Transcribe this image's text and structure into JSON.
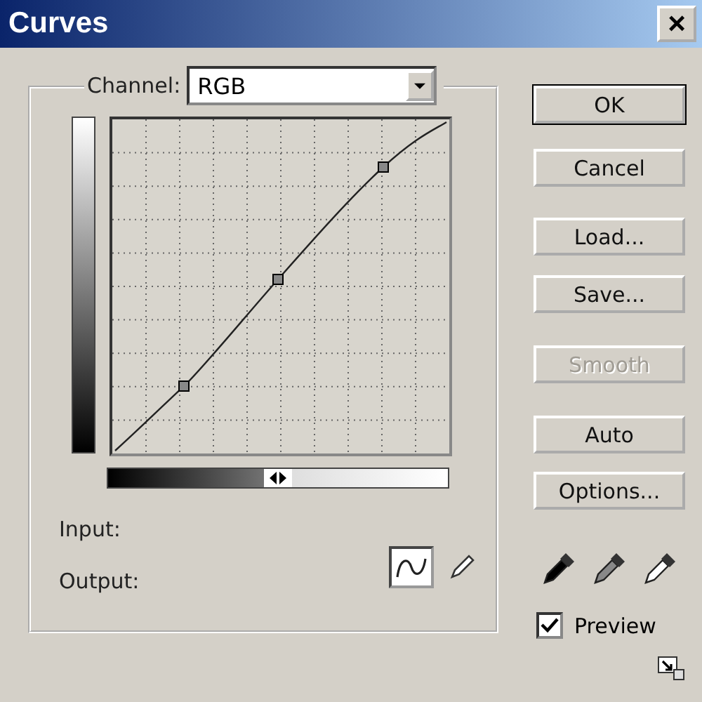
{
  "window": {
    "title": "Curves",
    "close": "×"
  },
  "channel": {
    "label": "Channel:",
    "value": "RGB"
  },
  "buttons": [
    {
      "label": "OK",
      "disabled": false,
      "default": true
    },
    {
      "label": "Cancel",
      "disabled": false,
      "default": false
    },
    {
      "label": "Load...",
      "disabled": false,
      "default": false
    },
    {
      "label": "Save...",
      "disabled": false,
      "default": false
    },
    {
      "label": "Smooth",
      "disabled": true,
      "default": false
    },
    {
      "label": "Auto",
      "disabled": false,
      "default": false
    },
    {
      "label": "Options...",
      "disabled": false,
      "default": false
    }
  ],
  "readouts": [
    {
      "label": "Input:"
    },
    {
      "label": "Output:"
    }
  ],
  "tools": [
    {
      "kind": "curve",
      "selected": true
    },
    {
      "kind": "pencil",
      "selected": false
    }
  ],
  "eyedroppers": [
    {
      "kind": "black"
    },
    {
      "kind": "gray"
    },
    {
      "kind": "white"
    }
  ],
  "preview": {
    "label": "Preview",
    "checked": true
  }
}
